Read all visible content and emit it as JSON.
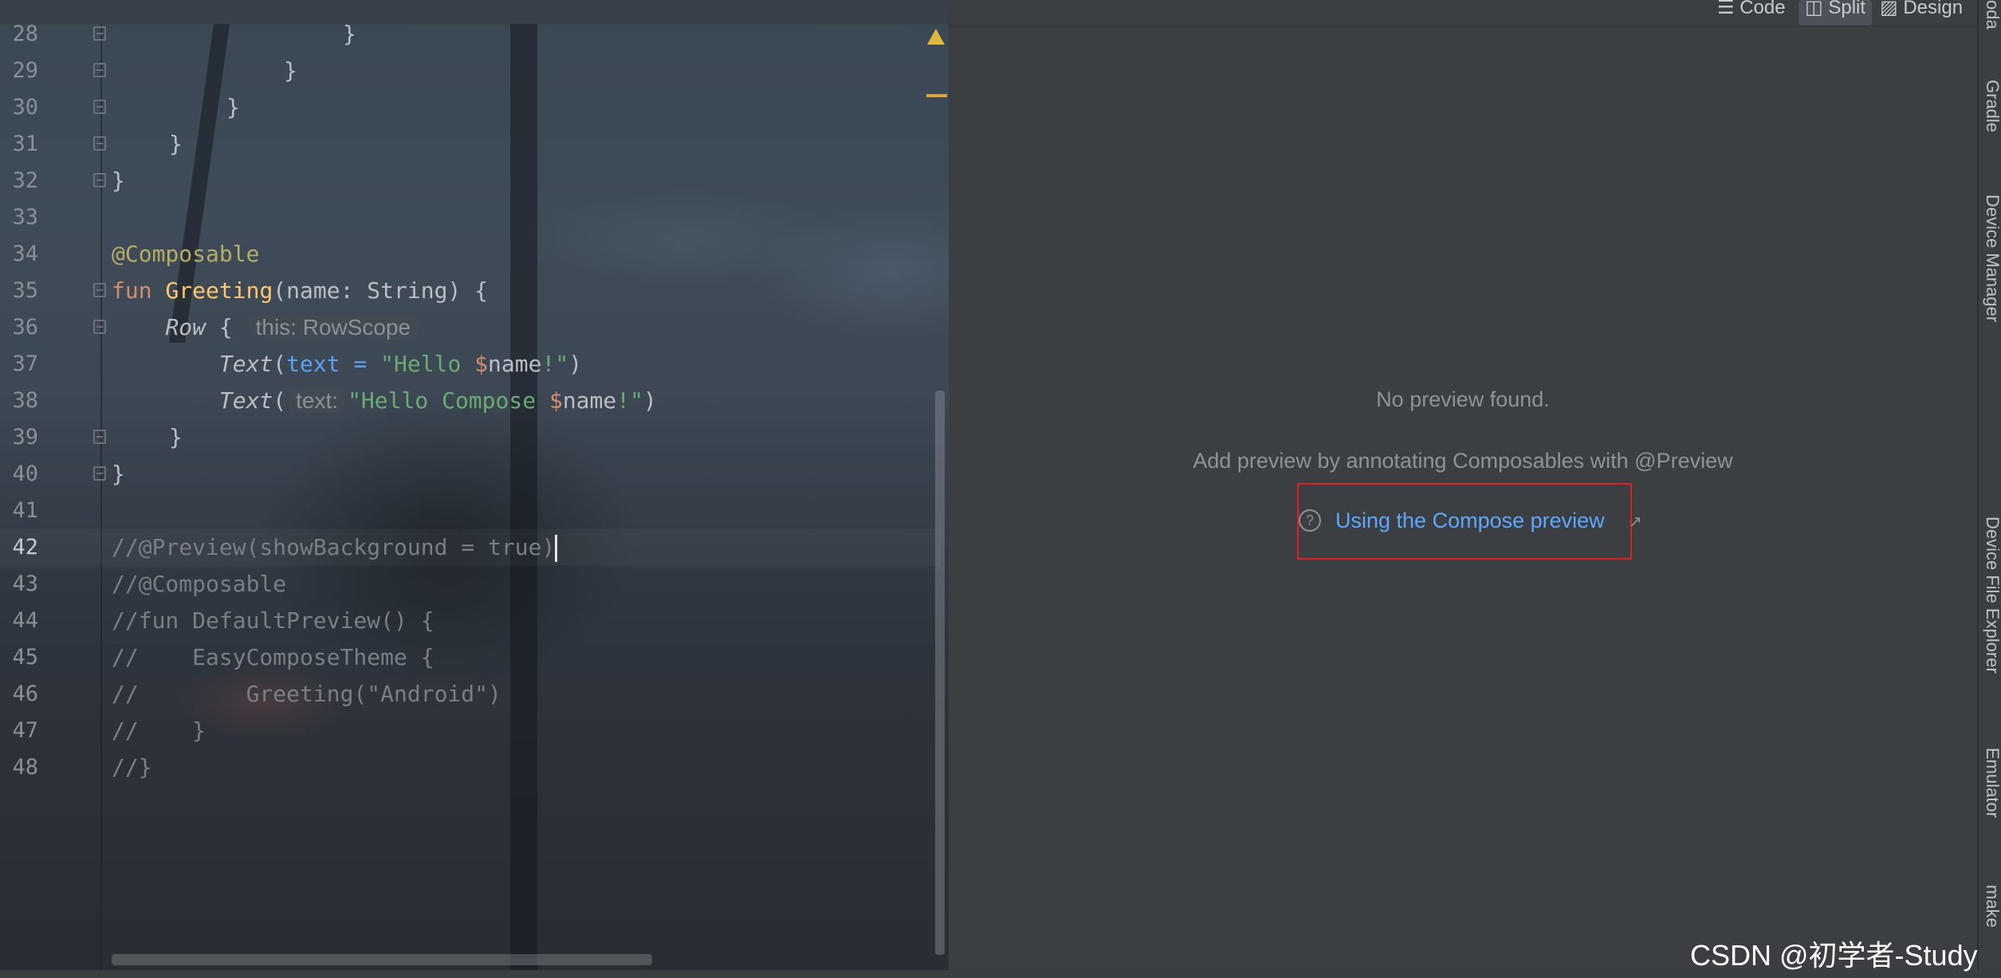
{
  "editor": {
    "lines": [
      {
        "n": "28"
      },
      {
        "n": "29"
      },
      {
        "n": "30"
      },
      {
        "n": "31"
      },
      {
        "n": "32"
      },
      {
        "n": "33"
      },
      {
        "n": "34"
      },
      {
        "n": "35"
      },
      {
        "n": "36"
      },
      {
        "n": "37"
      },
      {
        "n": "38"
      },
      {
        "n": "39"
      },
      {
        "n": "40"
      },
      {
        "n": "41"
      },
      {
        "n": "42"
      },
      {
        "n": "43"
      },
      {
        "n": "44"
      },
      {
        "n": "45"
      },
      {
        "n": "46"
      },
      {
        "n": "47"
      },
      {
        "n": "48"
      }
    ],
    "t": {
      "l28": "}",
      "l29": "}",
      "l30": "}",
      "l31": "}",
      "l32": "}",
      "l34_ann": "@Composable",
      "l35_kw": "fun",
      "l35_fn": "Greeting",
      "l35_params": "(name: String) {",
      "l36_row": "Row",
      "l36_brace": " {",
      "l36_hint": "this: RowScope",
      "l37_text": "Text",
      "l37_paren": "(",
      "l37_named": "text",
      "l37_eq": " = ",
      "l37_str1": "\"Hello ",
      "l37_dollar": "$",
      "l37_name": "name",
      "l37_str2": "!\"",
      "l37_close": ")",
      "l38_text": "Text",
      "l38_paren": "(",
      "l38_hint": "text:",
      "l38_str1": "\"Hello Compose ",
      "l38_dollar": "$",
      "l38_name": "name",
      "l38_str2": "!\"",
      "l38_close": ")",
      "l39": "}",
      "l40": "}",
      "l42": "//@Preview(showBackground = true)",
      "l43": "//@Composable",
      "l44": "//fun DefaultPreview() {",
      "l45": "//    EasyComposeTheme {",
      "l46": "//        Greeting(\"Android\")",
      "l47": "//    }",
      "l48": "//}"
    }
  },
  "preview": {
    "view_tabs": {
      "code": "Code",
      "split": "Split",
      "design": "Design"
    },
    "empty_title": "No preview found.",
    "empty_hint": "Add preview by annotating Composables with @Preview",
    "help_link": "Using the Compose preview",
    "help_icon": "?",
    "external_icon": "↗"
  },
  "right_toolbar": {
    "cut_top": "oda",
    "gradle": "Gradle",
    "device_manager": "Device Manager",
    "device_file_explorer": "Device File Explorer",
    "emulator": "Emulator",
    "make": "make"
  },
  "watermark": "CSDN @初学者-Study",
  "colors": {
    "link": "#5ea7ff",
    "highlight_box": "#e02020",
    "keyword": "#cf8e6d",
    "annotation": "#b3ae60",
    "function": "#ffc66d",
    "string": "#6aab73",
    "comment": "#7a7e85"
  }
}
